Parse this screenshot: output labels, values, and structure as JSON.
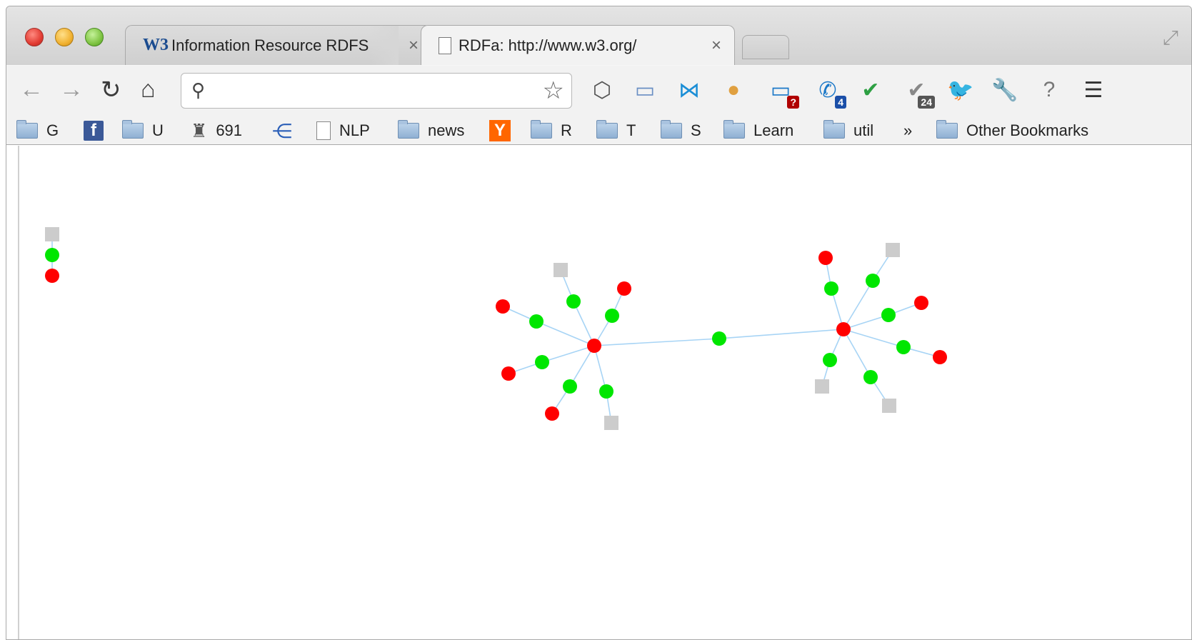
{
  "tabs": [
    {
      "logo": "W3",
      "title": "Information Resource RDFS",
      "close": "×"
    },
    {
      "title": "RDFa: http://www.w3.org/",
      "close": "×"
    }
  ],
  "toolbar": {
    "back_icon": "←",
    "forward_icon": "→",
    "reload_icon": "↻",
    "home_icon": "⌂",
    "omnibox_value": "",
    "star_icon": "☆",
    "extensions": [
      {
        "name": "tag-icon",
        "glyph": "⬡",
        "badge": ""
      },
      {
        "name": "screenshot-icon",
        "glyph": "▭",
        "badge": ""
      },
      {
        "name": "bowtie-icon",
        "glyph": "⋈",
        "badge": ""
      },
      {
        "name": "puffer-icon",
        "glyph": "●",
        "badge": ""
      },
      {
        "name": "window-icon",
        "glyph": "▭",
        "badge": "?"
      },
      {
        "name": "phone-icon",
        "glyph": "✆",
        "badge": "4"
      },
      {
        "name": "checkmark-icon",
        "glyph": "✔",
        "badge": ""
      },
      {
        "name": "check-circle-icon",
        "glyph": "✔",
        "badge": "24"
      },
      {
        "name": "twitter-icon",
        "glyph": "🐦",
        "badge": ""
      },
      {
        "name": "wrench-icon",
        "glyph": "🔧",
        "badge": ""
      },
      {
        "name": "scale-icon",
        "glyph": "?",
        "badge": ""
      },
      {
        "name": "menu-icon",
        "glyph": "☰",
        "badge": ""
      }
    ]
  },
  "bookmarks": {
    "items": [
      "G",
      "",
      "U",
      "691",
      "",
      "NLP",
      "news",
      "",
      "R",
      "T",
      "S",
      "Learn",
      "util"
    ],
    "overflow": "»",
    "other": "Other Bookmarks",
    "ycombinator_letter": "Y",
    "facebook_letter": "f"
  },
  "colors": {
    "node_red": "#ff0000",
    "node_green": "#00e600",
    "node_gray": "#cccccc",
    "link": "#a7d4f5"
  },
  "graph": {
    "nodes": [
      {
        "id": "L1",
        "type": "square"
      },
      {
        "id": "L2",
        "type": "green"
      },
      {
        "id": "L3",
        "type": "red"
      },
      {
        "id": "H1",
        "type": "red"
      },
      {
        "id": "H2",
        "type": "red"
      },
      {
        "id": "M",
        "type": "green"
      },
      {
        "id": "a1",
        "type": "square"
      },
      {
        "id": "a1g",
        "type": "green"
      },
      {
        "id": "a2",
        "type": "red"
      },
      {
        "id": "a2g",
        "type": "green"
      },
      {
        "id": "a3",
        "type": "red"
      },
      {
        "id": "a3g",
        "type": "green"
      },
      {
        "id": "a4",
        "type": "red"
      },
      {
        "id": "a4g",
        "type": "green"
      },
      {
        "id": "a5",
        "type": "red"
      },
      {
        "id": "a5g",
        "type": "green"
      },
      {
        "id": "a6",
        "type": "square"
      },
      {
        "id": "a6g",
        "type": "green"
      },
      {
        "id": "b1",
        "type": "red"
      },
      {
        "id": "b1g",
        "type": "green"
      },
      {
        "id": "b2",
        "type": "square"
      },
      {
        "id": "b2g",
        "type": "green"
      },
      {
        "id": "b3",
        "type": "red"
      },
      {
        "id": "b3g",
        "type": "green"
      },
      {
        "id": "b4",
        "type": "red"
      },
      {
        "id": "b4g",
        "type": "green"
      },
      {
        "id": "b5",
        "type": "square"
      },
      {
        "id": "b5g",
        "type": "green"
      },
      {
        "id": "b6",
        "type": "square"
      },
      {
        "id": "b6g",
        "type": "green"
      }
    ],
    "links": [
      [
        "L1",
        "L2"
      ],
      [
        "L2",
        "L3"
      ],
      [
        "H1",
        "M"
      ],
      [
        "M",
        "H2"
      ],
      [
        "H1",
        "a1g"
      ],
      [
        "a1g",
        "a1"
      ],
      [
        "H1",
        "a2g"
      ],
      [
        "a2g",
        "a2"
      ],
      [
        "H1",
        "a3g"
      ],
      [
        "a3g",
        "a3"
      ],
      [
        "H1",
        "a4g"
      ],
      [
        "a4g",
        "a4"
      ],
      [
        "H1",
        "a5g"
      ],
      [
        "a5g",
        "a5"
      ],
      [
        "H1",
        "a6g"
      ],
      [
        "a6g",
        "a6"
      ],
      [
        "H2",
        "b1g"
      ],
      [
        "b1g",
        "b1"
      ],
      [
        "H2",
        "b2g"
      ],
      [
        "b2g",
        "b2"
      ],
      [
        "H2",
        "b3g"
      ],
      [
        "b3g",
        "b3"
      ],
      [
        "H2",
        "b4g"
      ],
      [
        "b4g",
        "b4"
      ],
      [
        "H2",
        "b5g"
      ],
      [
        "b5g",
        "b5"
      ],
      [
        "H2",
        "b6g"
      ],
      [
        "b6g",
        "b6"
      ]
    ]
  }
}
